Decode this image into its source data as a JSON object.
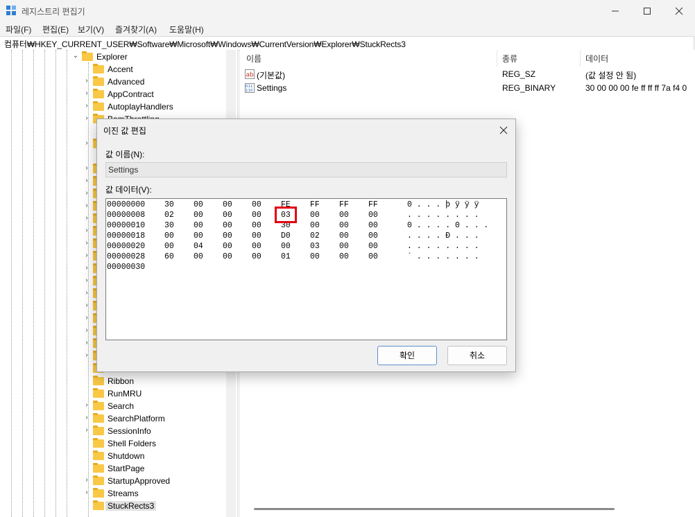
{
  "window": {
    "title": "레지스트리 편집기"
  },
  "menu": [
    "파일(F)",
    "편집(E)",
    "보기(V)",
    "즐겨찾기(A)",
    "도움말(H)"
  ],
  "address": "컴퓨터₩HKEY_CURRENT_USER₩Software₩Microsoft₩Windows₩CurrentVersion₩Explorer₩StuckRects3",
  "tree": {
    "parent": "Explorer",
    "items": [
      "Accent",
      "Advanced",
      "AppContract",
      "AutoplayHandlers",
      "BamThrottling",
      "Ribbon",
      "RunMRU",
      "Search",
      "SearchPlatform",
      "SessionInfo",
      "Shell Folders",
      "Shutdown",
      "StartPage",
      "StartupApproved",
      "Streams",
      "StuckRects3"
    ],
    "selected": "StuckRects3"
  },
  "list": {
    "headers": {
      "name": "이름",
      "type": "종류",
      "data": "데이터"
    },
    "rows": [
      {
        "name": "(기본값)",
        "type": "REG_SZ",
        "data": "(값 설정 안 됨)",
        "icon": "string-value-icon"
      },
      {
        "name": "Settings",
        "type": "REG_BINARY",
        "data": "30 00 00 00 fe ff ff ff 7a f4 0",
        "icon": "binary-value-icon"
      }
    ]
  },
  "dialog": {
    "title": "이진 값 편집",
    "name_label": "값 이름(N):",
    "name_value": "Settings",
    "data_label": "값 데이터(V):",
    "hex_rows": [
      {
        "offset": "00000000",
        "bytes": [
          "30",
          "00",
          "00",
          "00",
          "FE",
          "FF",
          "FF",
          "FF"
        ],
        "ascii": "0 . . . þ ÿ ÿ ÿ"
      },
      {
        "offset": "00000008",
        "bytes": [
          "02",
          "00",
          "00",
          "00",
          "03",
          "00",
          "00",
          "00"
        ],
        "ascii": ". . . . . . . ."
      },
      {
        "offset": "00000010",
        "bytes": [
          "30",
          "00",
          "00",
          "00",
          "30",
          "00",
          "00",
          "00"
        ],
        "ascii": "0 . . . . 0 . . ."
      },
      {
        "offset": "00000018",
        "bytes": [
          "00",
          "00",
          "00",
          "00",
          "D0",
          "02",
          "00",
          "00"
        ],
        "ascii": ". . . . Ð . . ."
      },
      {
        "offset": "00000020",
        "bytes": [
          "00",
          "04",
          "00",
          "00",
          "00",
          "03",
          "00",
          "00"
        ],
        "ascii": ". . . . . . . ."
      },
      {
        "offset": "00000028",
        "bytes": [
          "60",
          "00",
          "00",
          "00",
          "01",
          "00",
          "00",
          "00"
        ],
        "ascii": "` . . . . . . ."
      },
      {
        "offset": "00000030",
        "bytes": [],
        "ascii": ""
      }
    ],
    "ok_label": "확인",
    "cancel_label": "취소"
  },
  "colors": {
    "highlight": "#e3000f",
    "folder": "#f9c846",
    "accent": "#2f7fd3"
  }
}
